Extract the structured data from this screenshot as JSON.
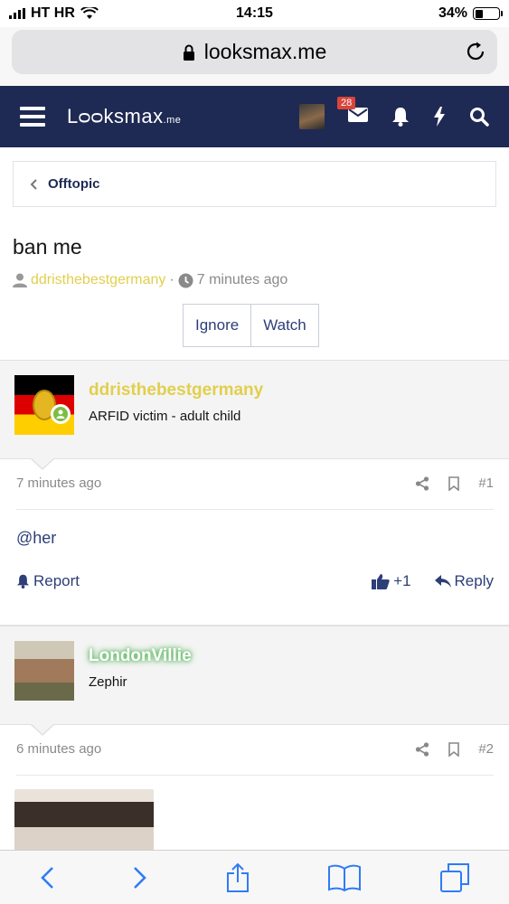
{
  "status_bar": {
    "carrier": "HT HR",
    "time": "14:15",
    "battery": "34%",
    "battery_level": 0.34
  },
  "browser": {
    "url": "looksmax.me"
  },
  "site": {
    "logo_main": "Lᴑᴑksmax",
    "logo_suffix": ".me",
    "notification_badge": "28"
  },
  "breadcrumb": {
    "label": "Offtopic"
  },
  "thread": {
    "title": "ban me",
    "author": "ddristhebestgermany",
    "separator": "·",
    "time": "7 minutes ago",
    "buttons": {
      "ignore": "Ignore",
      "watch": "Watch"
    }
  },
  "posts": [
    {
      "username": "ddristhebestgermany",
      "username_color": "#e2cf4d",
      "user_title": "ARFID victim - adult child",
      "time": "7 minutes ago",
      "number": "#1",
      "body": "@her",
      "report_label": "Report",
      "reaction_count": "+1",
      "reply_label": "Reply"
    },
    {
      "username": "LondonVillie",
      "username_color": "#ffffff",
      "user_title": "Zephir",
      "time": "6 minutes ago",
      "number": "#2"
    }
  ],
  "colors": {
    "nav_bg": "#1e2a54",
    "accent": "#2d3e78",
    "safari_blue": "#2f7cf6"
  },
  "icons": [
    "wifi-icon",
    "lock-icon",
    "reload-icon",
    "menu-icon",
    "envelope-icon",
    "bell-icon",
    "bolt-icon",
    "search-icon",
    "user-icon",
    "clock-icon",
    "share-icon",
    "bookmark-icon",
    "thumbs-up-icon",
    "reply-icon",
    "back-icon",
    "forward-icon",
    "share-sheet-icon",
    "bookmarks-icon",
    "tabs-icon"
  ]
}
